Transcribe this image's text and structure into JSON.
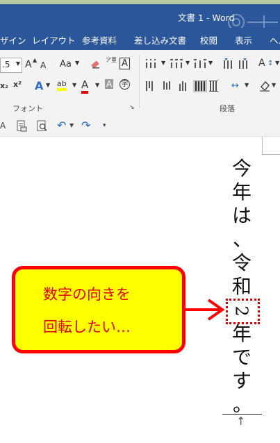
{
  "window": {
    "title": "文書 1 - Word"
  },
  "tabs": [
    "ザイン",
    "レイアウト",
    "参考資料",
    "差し込み文書",
    "校閲",
    "表示",
    "ヘル"
  ],
  "ribbon": {
    "font_size": ".5",
    "groups": {
      "font": "フォント",
      "paragraph": "段落"
    }
  },
  "icons": {
    "grow_font": "A",
    "shrink_font": "A",
    "change_case": "Aa",
    "furigana": "ア亜",
    "border_char": "A",
    "subscript": "x₂",
    "superscript": "x²",
    "text_effects": "A",
    "highlight": "ab",
    "font_color": "A",
    "char_shading": "A",
    "enclosed_char": "字",
    "sort": "A"
  },
  "document": {
    "line1": [
      "今",
      "年",
      "は",
      "、"
    ],
    "line2": [
      "令",
      "和",
      "2",
      "年",
      "で",
      "す",
      "。"
    ]
  },
  "callout": {
    "line1": "数字の向きを",
    "line2": "回転したい…"
  },
  "colors": {
    "accent": "#2b579a",
    "callout_border": "#ff0000",
    "callout_fill": "#ffff00"
  }
}
